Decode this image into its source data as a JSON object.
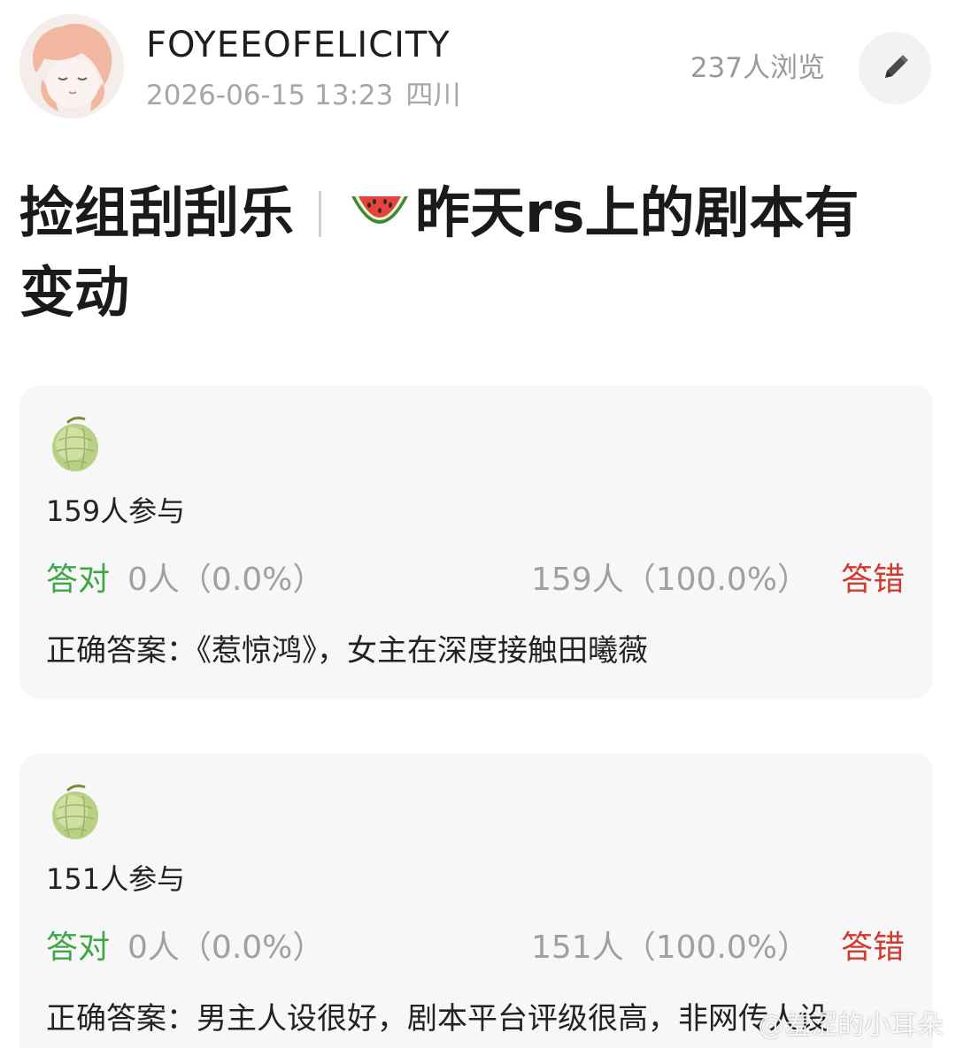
{
  "post": {
    "author": "FOYEEOFELICITY",
    "timestamp": "2026-06-15 13:23",
    "location": "四川",
    "views": "237人浏览",
    "edit_icon": "pencil-icon",
    "title_part1": "捡组刮刮乐",
    "title_icon": "watermelon-icon",
    "title_part2": "昨天rs上的剧本有变动"
  },
  "quizzes": [
    {
      "icon": "melon-icon",
      "participants": "159人参与",
      "correct_label": "答对",
      "correct_stats": "0人（0.0%）",
      "wrong_stats": "159人（100.0%）",
      "wrong_label": "答错",
      "answer": "正确答案：《惹惊鸿》，女主在深度接触田曦薇"
    },
    {
      "icon": "melon-icon",
      "participants": "151人参与",
      "correct_label": "答对",
      "correct_stats": "0人（0.0%）",
      "wrong_stats": "151人（100.0%）",
      "wrong_label": "答错",
      "answer": "正确答案：男主人设很好，剧本平台评级很高，非网传人设"
    }
  ],
  "watermark": "@羞涩的小耳朵",
  "colors": {
    "correct": "#3fa648",
    "wrong": "#d03a2f",
    "muted": "#a0a0a0",
    "card_bg": "#f7f7f7"
  }
}
